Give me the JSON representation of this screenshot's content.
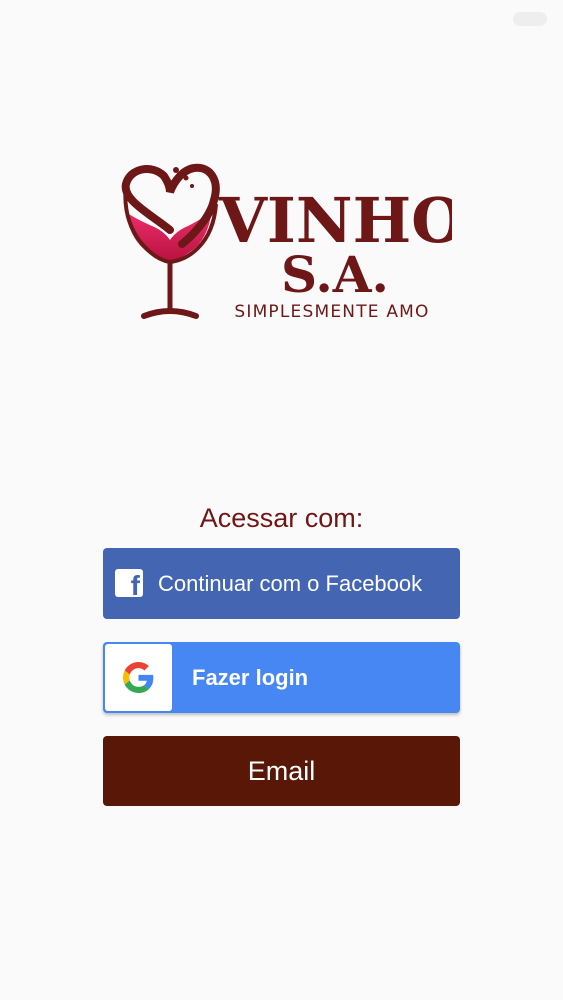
{
  "app": {
    "brand_line1": "VINHO",
    "brand_line2": "S.A.",
    "tagline": "SIMPLESMENTE AMO"
  },
  "login": {
    "prompt": "Acessar com:",
    "facebook_label": "Continuar com o Facebook",
    "google_label": "Fazer login",
    "email_label": "Email"
  },
  "colors": {
    "brand_dark": "#701615",
    "facebook": "#4466b2",
    "google": "#4687f3",
    "email": "#591707",
    "wine": "#d11b55"
  },
  "icons": {
    "logo": "wine-glass-heart-icon",
    "facebook": "facebook-icon",
    "google": "google-g-icon"
  }
}
